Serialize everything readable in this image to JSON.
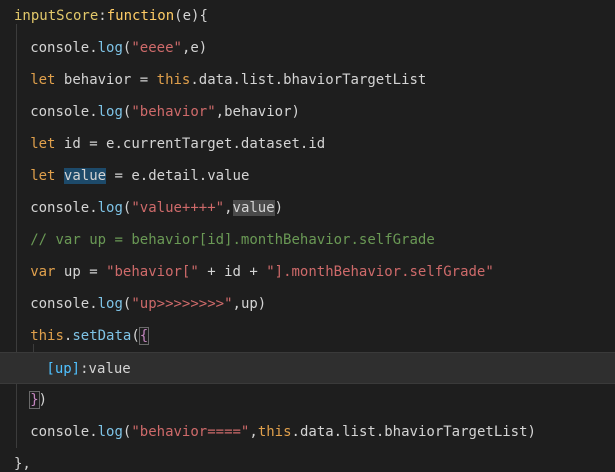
{
  "editor": {
    "lines": [
      {
        "indent": 0,
        "tokens": [
          {
            "text": "inputScore",
            "style": "yellow"
          },
          {
            "text": ":",
            "style": "plain"
          },
          {
            "text": "function",
            "style": "func"
          },
          {
            "text": "(e){",
            "style": "plain"
          }
        ]
      },
      {
        "indent": 2,
        "tokens": [
          {
            "text": "console.",
            "style": "plain"
          },
          {
            "text": "log",
            "style": "method"
          },
          {
            "text": "(",
            "style": "plain"
          },
          {
            "text": "\"eeee\"",
            "style": "string"
          },
          {
            "text": ",e)",
            "style": "plain"
          }
        ]
      },
      {
        "indent": 2,
        "tokens": [
          {
            "text": "let",
            "style": "keyword"
          },
          {
            "text": " behavior = ",
            "style": "plain"
          },
          {
            "text": "this",
            "style": "this"
          },
          {
            "text": ".data.list.bhaviorTargetList",
            "style": "plain"
          }
        ]
      },
      {
        "indent": 2,
        "tokens": [
          {
            "text": "console.",
            "style": "plain"
          },
          {
            "text": "log",
            "style": "method"
          },
          {
            "text": "(",
            "style": "plain"
          },
          {
            "text": "\"behavior\"",
            "style": "string"
          },
          {
            "text": ",behavior)",
            "style": "plain"
          }
        ]
      },
      {
        "indent": 2,
        "tokens": [
          {
            "text": "let",
            "style": "keyword"
          },
          {
            "text": " id = e.currentTarget.dataset.id",
            "style": "plain"
          }
        ]
      },
      {
        "indent": 2,
        "tokens": [
          {
            "text": "let",
            "style": "keyword"
          },
          {
            "text": " ",
            "style": "plain"
          },
          {
            "text": "value",
            "style": "plain",
            "highlight": "sel"
          },
          {
            "text": " = e.detail.value",
            "style": "plain"
          }
        ]
      },
      {
        "indent": 2,
        "tokens": [
          {
            "text": "console.",
            "style": "plain"
          },
          {
            "text": "log",
            "style": "method"
          },
          {
            "text": "(",
            "style": "plain"
          },
          {
            "text": "\"value++++\"",
            "style": "string"
          },
          {
            "text": ",",
            "style": "plain"
          },
          {
            "text": "value",
            "style": "plain",
            "highlight": "occ"
          },
          {
            "text": ")",
            "style": "plain"
          }
        ]
      },
      {
        "indent": 2,
        "tokens": [
          {
            "text": "// var up = behavior[id].monthBehavior.selfGrade",
            "style": "comment"
          }
        ]
      },
      {
        "indent": 2,
        "tokens": [
          {
            "text": "var",
            "style": "keyword"
          },
          {
            "text": " up = ",
            "style": "plain"
          },
          {
            "text": "\"behavior[\"",
            "style": "string"
          },
          {
            "text": " + id + ",
            "style": "plain"
          },
          {
            "text": "\"].monthBehavior.selfGrade\"",
            "style": "string"
          }
        ]
      },
      {
        "indent": 2,
        "tokens": [
          {
            "text": "console.",
            "style": "plain"
          },
          {
            "text": "log",
            "style": "method"
          },
          {
            "text": "(",
            "style": "plain"
          },
          {
            "text": "\"up>>>>>>>>\"",
            "style": "string"
          },
          {
            "text": ",up)",
            "style": "plain"
          }
        ]
      },
      {
        "indent": 2,
        "tokens": [
          {
            "text": "this",
            "style": "this"
          },
          {
            "text": ".",
            "style": "plain"
          },
          {
            "text": "setData",
            "style": "method"
          },
          {
            "text": "(",
            "style": "plain"
          },
          {
            "text": "{",
            "style": "bracket-purple",
            "box": true
          }
        ]
      },
      {
        "indent": 4,
        "current": true,
        "tokens": [
          {
            "text": "[up]",
            "style": "bracket-blue"
          },
          {
            "text": ":value",
            "style": "plain"
          }
        ]
      },
      {
        "indent": 2,
        "tokens": [
          {
            "text": "}",
            "style": "bracket-purple",
            "box": true
          },
          {
            "text": ")",
            "style": "plain"
          }
        ]
      },
      {
        "indent": 2,
        "tokens": [
          {
            "text": "console.",
            "style": "plain"
          },
          {
            "text": "log",
            "style": "method"
          },
          {
            "text": "(",
            "style": "plain"
          },
          {
            "text": "\"behavior====\"",
            "style": "string"
          },
          {
            "text": ",",
            "style": "plain"
          },
          {
            "text": "this",
            "style": "this"
          },
          {
            "text": ".data.list.bhaviorTargetList)",
            "style": "plain"
          }
        ]
      },
      {
        "indent": 0,
        "tokens": [
          {
            "text": "},",
            "style": "plain"
          }
        ]
      }
    ]
  }
}
